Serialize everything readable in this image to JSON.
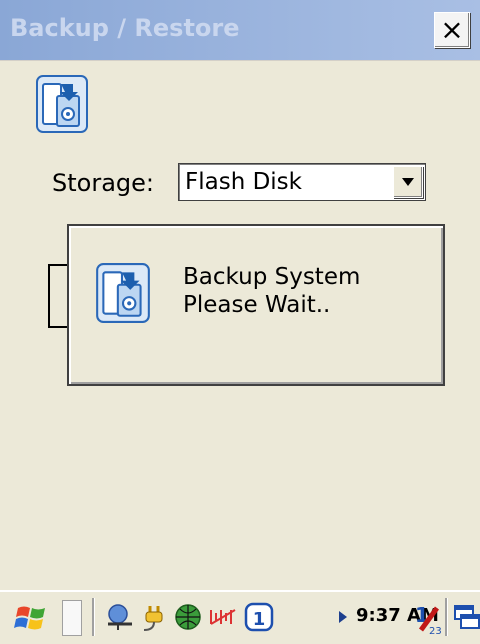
{
  "window": {
    "title": "Backup / Restore",
    "close_label": "×"
  },
  "form": {
    "storage_label": "Storage:",
    "storage_value": "Flash Disk"
  },
  "dialog": {
    "line1": "Backup System",
    "line2": "Please Wait.."
  },
  "taskbar": {
    "time": "9:37 AM",
    "indicator": "1"
  }
}
